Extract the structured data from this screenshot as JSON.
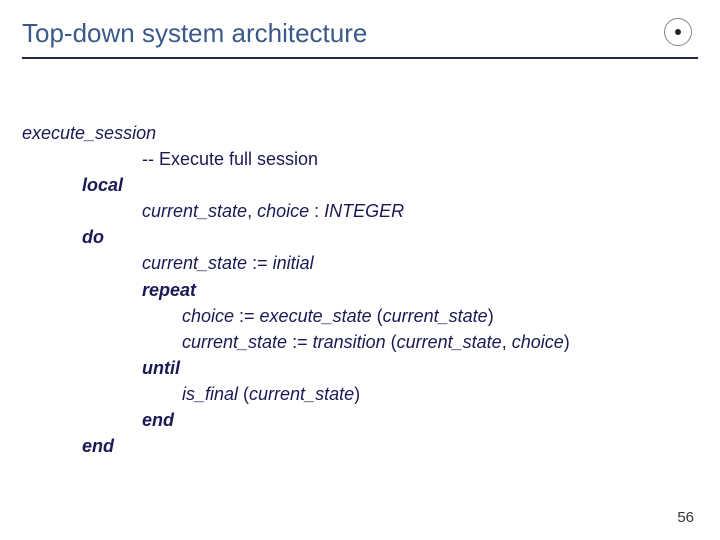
{
  "header": {
    "title": "Top-down system architecture"
  },
  "code": {
    "proc_name": "execute_session",
    "comment": "-- Execute full session",
    "kw_local": "local",
    "decl_line": {
      "var1": "current_state",
      "sep": ", ",
      "var2": "choice ",
      "colon": ": ",
      "type": "INTEGER"
    },
    "kw_do": "do",
    "assign1": {
      "lhs": "current_state",
      "op": " := ",
      "rhs": "initial"
    },
    "kw_repeat": "repeat",
    "line_choice": {
      "lhs": "choice",
      "op": " := ",
      "fn": "execute_state",
      "open": " (",
      "arg": "current_state",
      "close": ")"
    },
    "line_trans": {
      "lhs": "current_state",
      "op": " := ",
      "fn": "transition",
      "open": " (",
      "arg1": "current_state",
      "comma": ", ",
      "arg2": "choice",
      "close": ")"
    },
    "kw_until": "until",
    "line_final": {
      "fn": "is_final",
      "open": " (",
      "arg": "current_state",
      "close": ")"
    },
    "kw_end1": "end",
    "kw_end2": "end"
  },
  "page_number": "56"
}
